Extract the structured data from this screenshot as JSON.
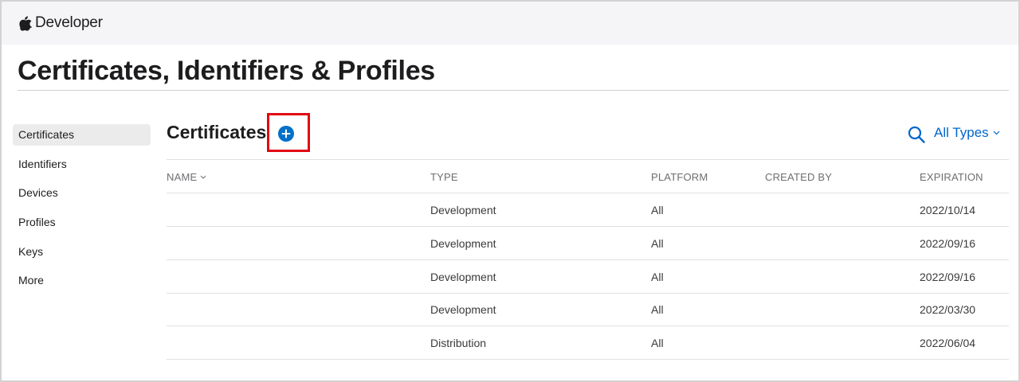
{
  "header": {
    "brand_label": "Developer",
    "logo_icon": "apple-logo"
  },
  "page_title": "Certificates, Identifiers & Profiles",
  "sidebar": {
    "items": [
      {
        "label": "Certificates",
        "active": true
      },
      {
        "label": "Identifiers",
        "active": false
      },
      {
        "label": "Devices",
        "active": false
      },
      {
        "label": "Profiles",
        "active": false
      },
      {
        "label": "Keys",
        "active": false
      },
      {
        "label": "More",
        "active": false
      }
    ]
  },
  "section": {
    "title": "Certificates",
    "add_icon": "plus-circle-icon",
    "search_icon": "search-icon",
    "type_filter_label": "All Types",
    "accent_color": "#0070c9",
    "highlight_color": "#e30613"
  },
  "table": {
    "columns": {
      "name": "NAME",
      "type": "TYPE",
      "platform": "PLATFORM",
      "created_by": "CREATED BY",
      "expiration": "EXPIRATION"
    },
    "rows": [
      {
        "name": "",
        "type": "Development",
        "platform": "All",
        "created_by": "",
        "expiration": "2022/10/14"
      },
      {
        "name": "",
        "type": "Development",
        "platform": "All",
        "created_by": "",
        "expiration": "2022/09/16"
      },
      {
        "name": "",
        "type": "Development",
        "platform": "All",
        "created_by": "",
        "expiration": "2022/09/16"
      },
      {
        "name": "",
        "type": "Development",
        "platform": "All",
        "created_by": "",
        "expiration": "2022/03/30"
      },
      {
        "name": "",
        "type": "Distribution",
        "platform": "All",
        "created_by": "",
        "expiration": "2022/06/04"
      }
    ]
  }
}
